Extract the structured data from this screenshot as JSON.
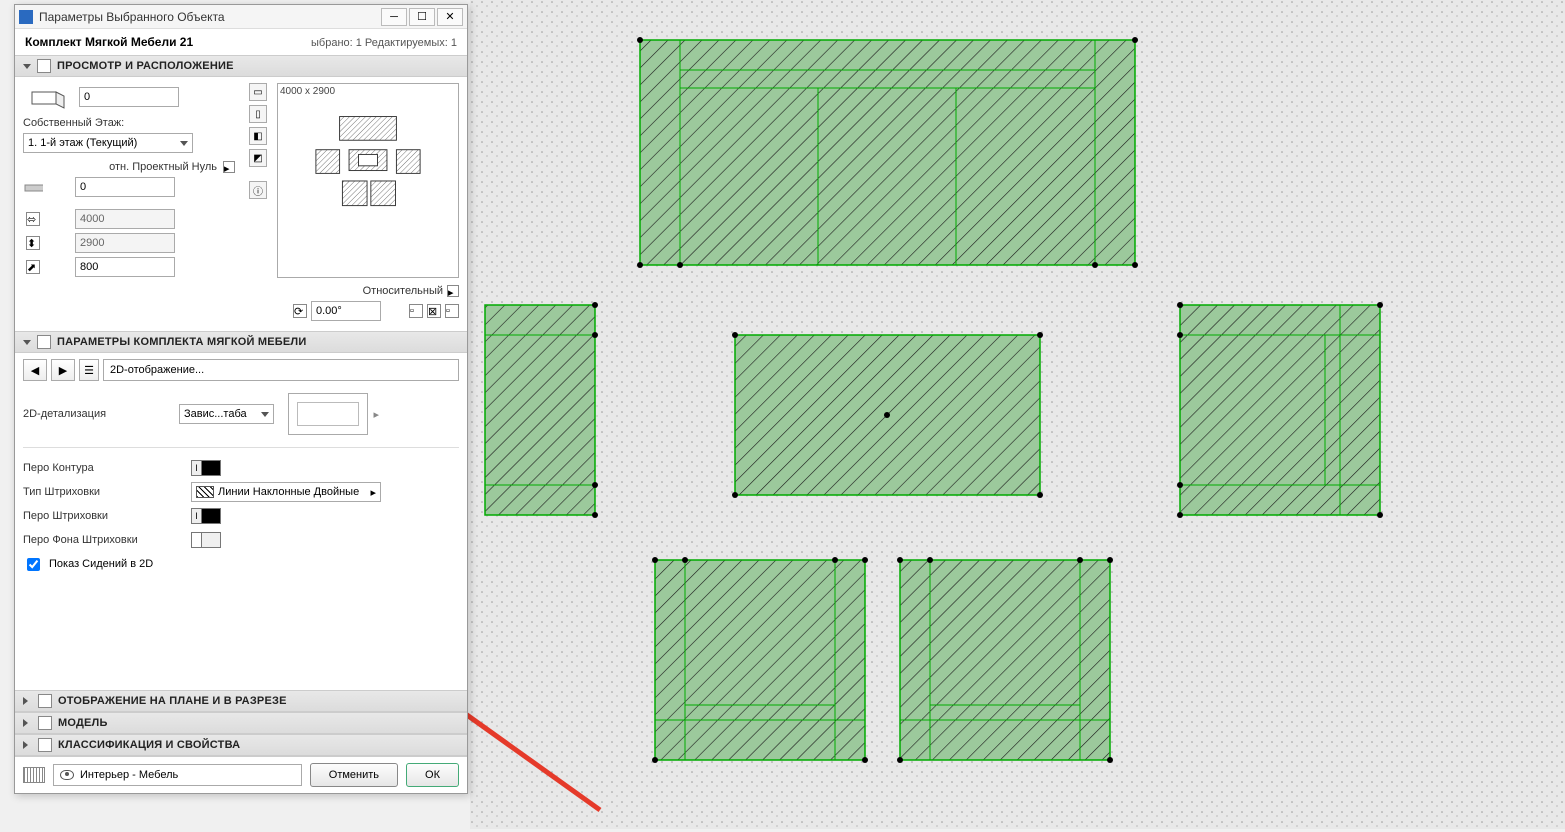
{
  "dialog": {
    "title": "Параметры Выбранного Объекта",
    "object_name": "Комплект Мягкой Мебели 21",
    "selected_info": "ыбрано: 1 Редактируемых: 1"
  },
  "sections": {
    "preview": {
      "title": "ПРОСМОТР И РАСПОЛОЖЕНИЕ"
    },
    "params": {
      "title": "ПАРАМЕТРЫ КОМПЛЕКТА МЯГКОЙ МЕБЕЛИ"
    },
    "plan": {
      "title": "ОТОБРАЖЕНИЕ НА ПЛАНЕ И В РАЗРЕЗЕ"
    },
    "model": {
      "title": "МОДЕЛЬ"
    },
    "classif": {
      "title": "КЛАССИФИКАЦИЯ И СВОЙСТВА"
    }
  },
  "preview": {
    "dims_label": "4000 x 2900",
    "elev_top": "0",
    "own_story_label": "Собственный Этаж:",
    "own_story_value": "1. 1-й этаж (Текущий)",
    "ref_label": "отн. Проектный Нуль",
    "elev_bottom": "0",
    "dim_x": "4000",
    "dim_y": "2900",
    "dim_z": "800",
    "rel_label": "Относительный",
    "angle": "0.00°"
  },
  "params": {
    "nav_label": "2D-отображение...",
    "detail_label": "2D-детализация",
    "detail_value": "Завис...таба",
    "contour_pen": "Перо Контура",
    "contour_pen_color": "#000000",
    "hatch_type": "Тип Штриховки",
    "hatch_value": "Линии Наклонные Двойные",
    "hatch_pen": "Перо Штриховки",
    "hatch_pen_color": "#000000",
    "hatch_bg_pen": "Перо Фона Штриховки",
    "hatch_bg_color": "#f0f0f0",
    "show_seats": "Показ Сидений в 2D"
  },
  "footer": {
    "layer": "Интерьер - Мебель",
    "cancel": "Отменить",
    "ok": "ОК"
  }
}
